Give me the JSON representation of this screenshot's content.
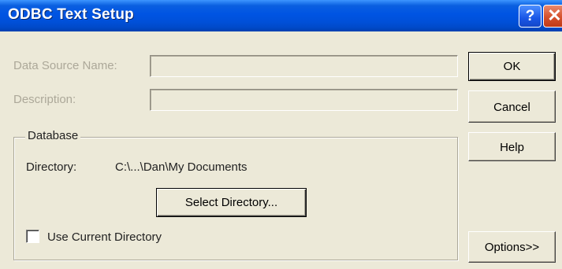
{
  "window": {
    "title": "ODBC Text Setup"
  },
  "titlebar": {
    "help_glyph": "?",
    "close_glyph": "✕"
  },
  "form": {
    "data_source_name_label": "Data Source Name:",
    "data_source_name_value": "",
    "description_label": "Description:",
    "description_value": ""
  },
  "buttons": {
    "ok": "OK",
    "cancel": "Cancel",
    "help": "Help",
    "options": "Options>>"
  },
  "database": {
    "group_title": "Database",
    "directory_label": "Directory:",
    "directory_value": "C:\\...\\Dan\\My Documents",
    "select_directory": "Select Directory...",
    "use_current_directory": "Use Current Directory",
    "use_current_directory_checked": false
  },
  "colors": {
    "titlebar_blue": "#0054e3",
    "close_red": "#d5502c",
    "dialog_face": "#ece9d8",
    "disabled_text": "#aca899"
  }
}
